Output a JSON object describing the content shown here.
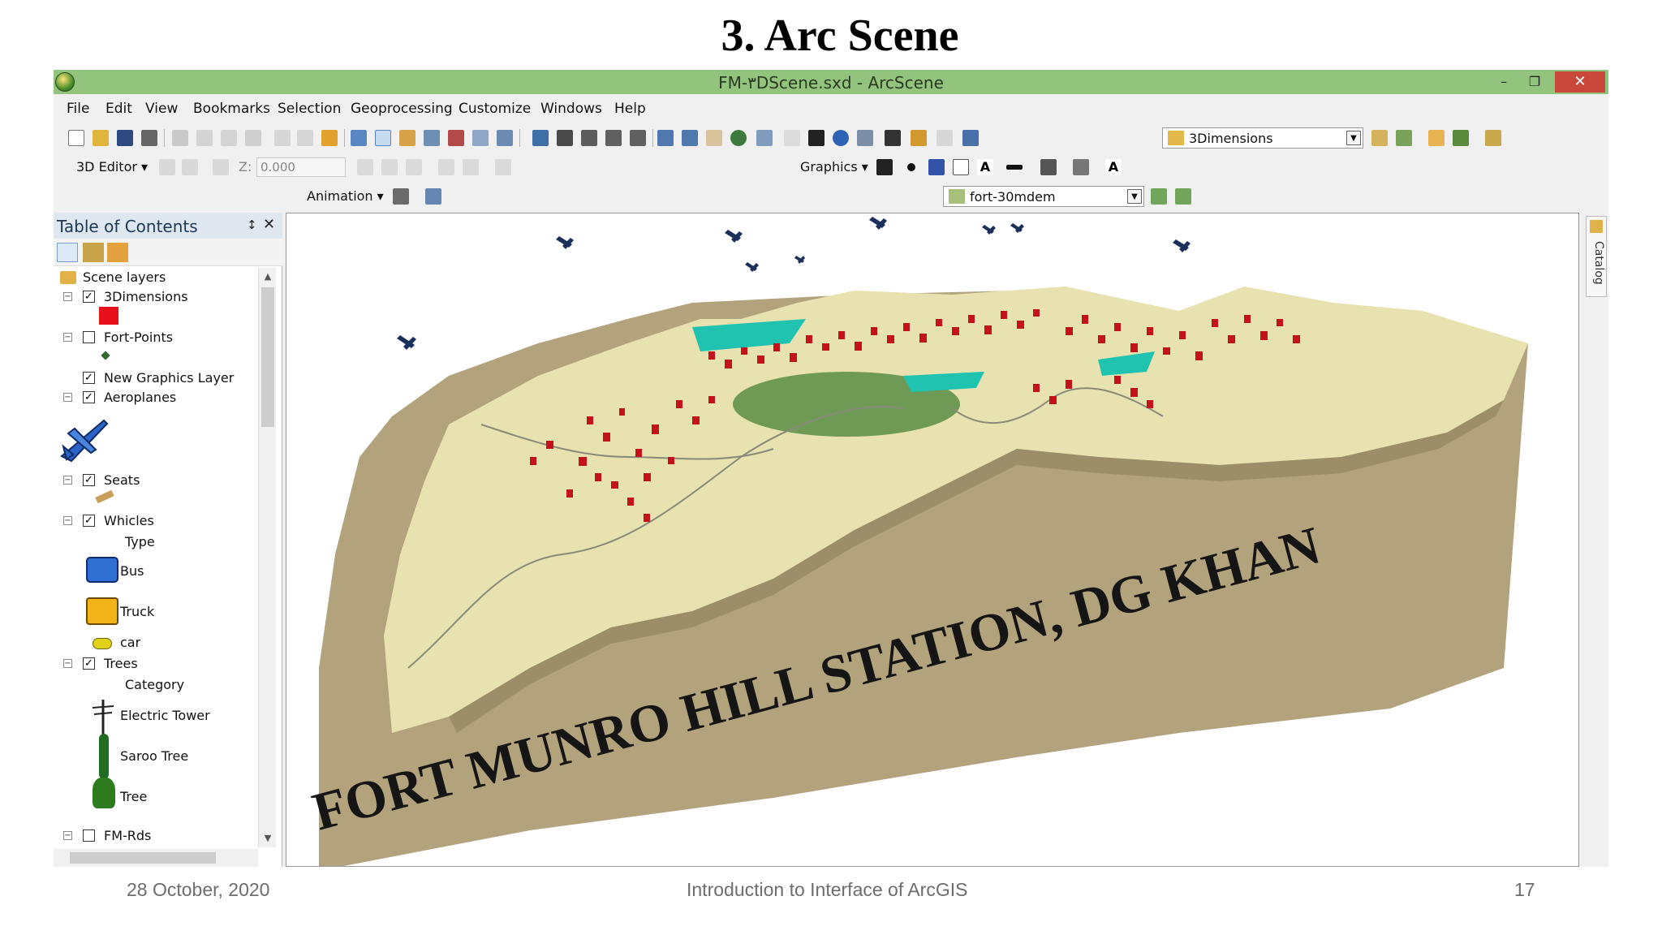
{
  "slide": {
    "title": "3. Arc Scene",
    "footer_date": "28 October, 2020",
    "footer_center": "Introduction to Interface of ArcGIS",
    "page_number": "17"
  },
  "window": {
    "title": "FM-۳DScene.sxd - ArcScene",
    "minimize": "–",
    "restore": "❐",
    "close": "✕"
  },
  "menu": [
    "File",
    "Edit",
    "View",
    "Bookmarks",
    "Selection",
    "Geoprocessing",
    "Customize",
    "Windows",
    "Help"
  ],
  "toolbars": {
    "layer_combo": "3Dimensions",
    "editor_label": "3D Editor ▾",
    "z_label": "Z:",
    "z_value": "0.000",
    "graphics_label": "Graphics ▾",
    "animation_label": "Animation ▾",
    "surface_combo": "fort-30mdem"
  },
  "toc": {
    "title": "Table of Contents",
    "pin": "↕",
    "close": "✕",
    "items": [
      {
        "label": "Scene layers"
      },
      {
        "label": "3Dimensions"
      },
      {
        "label": "Fort-Points"
      },
      {
        "label": "New Graphics Layer"
      },
      {
        "label": "Aeroplanes"
      },
      {
        "label": "Seats"
      },
      {
        "label": "Whicles"
      },
      {
        "label": "Type"
      },
      {
        "label": "Bus"
      },
      {
        "label": "Truck"
      },
      {
        "label": "car"
      },
      {
        "label": "Trees"
      },
      {
        "label": "Category"
      },
      {
        "label": "Electric Tower"
      },
      {
        "label": "Saroo Tree"
      },
      {
        "label": "Tree"
      },
      {
        "label": "FM-Rds"
      }
    ]
  },
  "scene": {
    "banner_text": "FORT MUNRO HILL STATION, DG KHAN"
  },
  "catalog_tab": "Catalog",
  "colors": {
    "titlebar": "#93c47d",
    "terrain_top": "#e8e2b0",
    "terrain_side": "#b3a37d",
    "buildings": "#c4121c",
    "water": "#1fc3b0",
    "park": "#6e9a55"
  }
}
